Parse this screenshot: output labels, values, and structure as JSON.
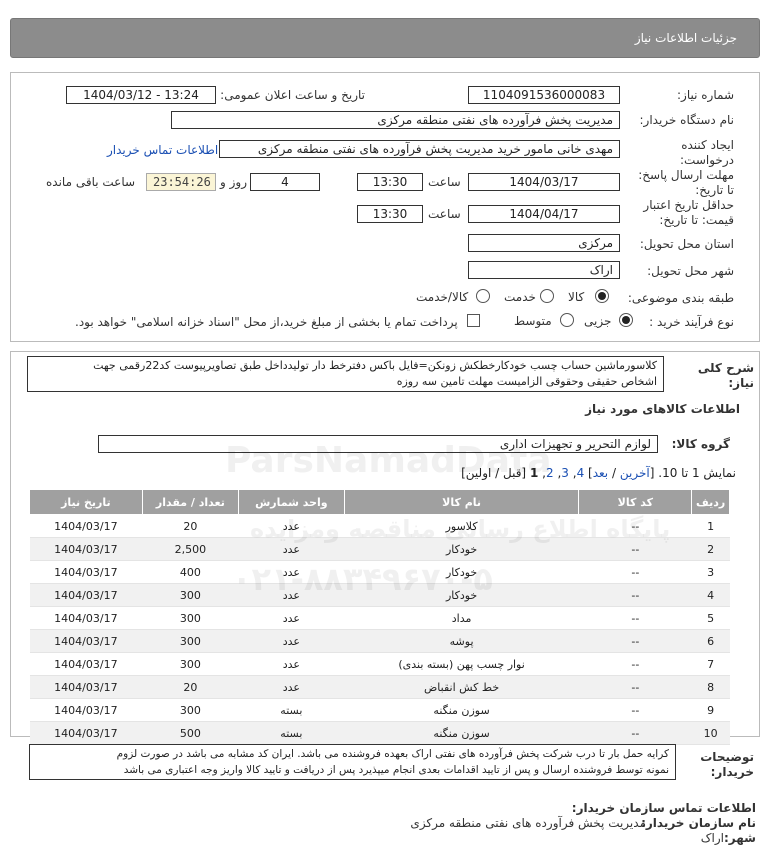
{
  "header": {
    "title": "جزئیات اطلاعات نیاز"
  },
  "form": {
    "need_number_label": "شماره نیاز:",
    "need_number": "1104091536000083",
    "announce_label": "تاریخ و ساعت اعلان عمومی:",
    "announce_value": "1404/03/12 - 13:24",
    "buyer_org_label": "نام دستگاه خریدار:",
    "buyer_org": "مدیریت پخش فرآورده های نفتی منطقه مرکزی",
    "creator_label_1": "ایجاد کننده",
    "creator_label_2": "درخواست:",
    "creator": "مهدی خانی مامور خرید مدیریت پخش فرآورده های نفتی منطقه مرکزی",
    "contact_link": "اطلاعات تماس خریدار",
    "deadline_label_1": "مهلت ارسال پاسخ:",
    "deadline_label_2": "تا تاریخ:",
    "deadline_date": "1404/03/17",
    "time_label": "ساعت",
    "deadline_time": "13:30",
    "days": "4",
    "days_label": "روز و",
    "remaining": "23:54:26",
    "remaining_label": "ساعت باقی مانده",
    "validity_label_1": "حداقل تاریخ اعتبار",
    "validity_label_2": "قیمت: تا تاریخ:",
    "validity_date": "1404/04/17",
    "validity_time": "13:30",
    "province_label": "استان محل تحویل:",
    "province": "مرکزی",
    "city_label": "شهر محل تحویل:",
    "city": "اراک",
    "category_label": "طبقه بندی موضوعی:",
    "category_options": [
      "کالا",
      "خدمت",
      "کالا/خدمت"
    ],
    "process_label": "نوع فرآیند خرید :",
    "process_options": [
      "جزیی",
      "متوسط"
    ],
    "treasury_text": "پرداخت تمام یا بخشی از مبلغ خرید،از محل \"اسناد خزانه اسلامی\" خواهد بود."
  },
  "summary": {
    "label_1": "شرح کلی",
    "label_2": "نیاز:",
    "text_line1": "کلاسورماشین حساب چسب خودکارخطکش زونکن=فایل باکس دفترخط دار تولیدداخل طبق تصاویرپیوست کد22رقمی جهت",
    "text_line2": "اشخاص حقیقی وحقوقی الزامیست مهلت تامین سه روزه"
  },
  "goods": {
    "section_title": "اطلاعات کالاهای مورد نیاز",
    "group_label": "گروه کالا:",
    "group_value": "لوازم التحریر و تجهیزات اداری"
  },
  "pagination": {
    "showing": "نمایش 1 تا 10.",
    "last": "آخرین",
    "next": "بعد",
    "p4": "4",
    "p3": "3",
    "p2": "2",
    "current": "1",
    "prev_first": "[قبل / اولین]"
  },
  "table": {
    "headers": [
      "ردیف",
      "کد کالا",
      "نام کالا",
      "واحد شمارش",
      "تعداد / مقدار",
      "تاریخ نیاز"
    ],
    "rows": [
      [
        "1",
        "--",
        "کلاسور",
        "عدد",
        "20",
        "1404/03/17"
      ],
      [
        "2",
        "--",
        "خودکار",
        "عدد",
        "2,500",
        "1404/03/17"
      ],
      [
        "3",
        "--",
        "خودکار",
        "عدد",
        "400",
        "1404/03/17"
      ],
      [
        "4",
        "--",
        "خودکار",
        "عدد",
        "300",
        "1404/03/17"
      ],
      [
        "5",
        "--",
        "مداد",
        "عدد",
        "300",
        "1404/03/17"
      ],
      [
        "6",
        "--",
        "پوشه",
        "عدد",
        "300",
        "1404/03/17"
      ],
      [
        "7",
        "--",
        "نوار چسب پهن (بسته بندی)",
        "عدد",
        "300",
        "1404/03/17"
      ],
      [
        "8",
        "--",
        "خط کش انقباض",
        "عدد",
        "20",
        "1404/03/17"
      ],
      [
        "9",
        "--",
        "سوزن منگنه",
        "بسته",
        "300",
        "1404/03/17"
      ],
      [
        "10",
        "--",
        "سوزن منگنه",
        "بسته",
        "500",
        "1404/03/17"
      ]
    ]
  },
  "notes": {
    "label_1": "توضیحات",
    "label_2": "خریدار:",
    "line1": "کرایه حمل بار تا درب شرکت پخش فرآورده های نفتی اراک بعهده فروشنده می باشد. ایران کد مشابه می باشد در صورت لزوم",
    "line2": "نمونه توسط فروشنده ارسال و پس از تایید اقدامات بعدی انجام میپذیرد پس از دریافت و تایید کالا واریز وجه اعتباری می باشد"
  },
  "contact": {
    "title": "اطلاعات تماس سازمان خریدار:",
    "org_label": "نام سازمان خریدار:",
    "org": "مدیریت پخش فرآورده های نفتی منطقه مرکزی",
    "city_label": "شهر:",
    "city": "اراک"
  },
  "watermark": {
    "brand": "ParsNamadData",
    "line1": "پایگاه اطلاع رسانی مناقصه ومزایده",
    "phone": "۰۲۱-۸۸۳۴۹۶۷۰-۵"
  }
}
